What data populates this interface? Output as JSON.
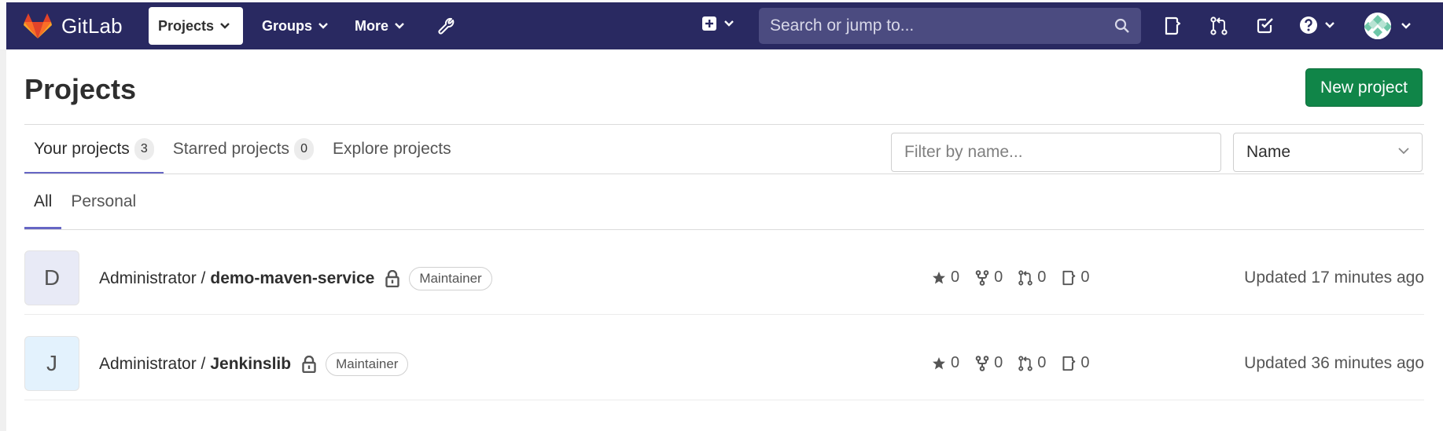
{
  "nav": {
    "brand": "GitLab",
    "projects_label": "Projects",
    "groups_label": "Groups",
    "more_label": "More",
    "search_placeholder": "Search or jump to..."
  },
  "page": {
    "title": "Projects",
    "new_project_label": "New project"
  },
  "tabs": [
    {
      "label": "Your projects",
      "count": "3",
      "active": true
    },
    {
      "label": "Starred projects",
      "count": "0",
      "active": false
    },
    {
      "label": "Explore projects",
      "active": false
    }
  ],
  "filter": {
    "placeholder": "Filter by name..."
  },
  "sort": {
    "selected": "Name"
  },
  "subtabs": [
    {
      "label": "All",
      "active": true
    },
    {
      "label": "Personal",
      "active": false
    }
  ],
  "projects": [
    {
      "avatar_letter": "D",
      "avatar_color": "#e8eaf6",
      "namespace": "Administrator /",
      "name": "demo-maven-service",
      "role": "Maintainer",
      "stars": "0",
      "forks": "0",
      "merge_requests": "0",
      "issues": "0",
      "updated": "Updated 17 minutes ago"
    },
    {
      "avatar_letter": "J",
      "avatar_color": "#e3f2fd",
      "namespace": "Administrator /",
      "name": "Jenkinslib",
      "role": "Maintainer",
      "stars": "0",
      "forks": "0",
      "merge_requests": "0",
      "issues": "0",
      "updated": "Updated 36 minutes ago"
    }
  ],
  "colors": {
    "navbar": "#292961",
    "accent": "#6666c4",
    "new_project_button": "#108548"
  },
  "icons": [
    "gitlab-logo",
    "chevron-down-icon",
    "wrench-icon",
    "plus-square-icon",
    "search-icon",
    "issues-icon",
    "merge-request-icon",
    "todo-icon",
    "help-icon",
    "lock-icon",
    "star-icon",
    "fork-icon"
  ]
}
